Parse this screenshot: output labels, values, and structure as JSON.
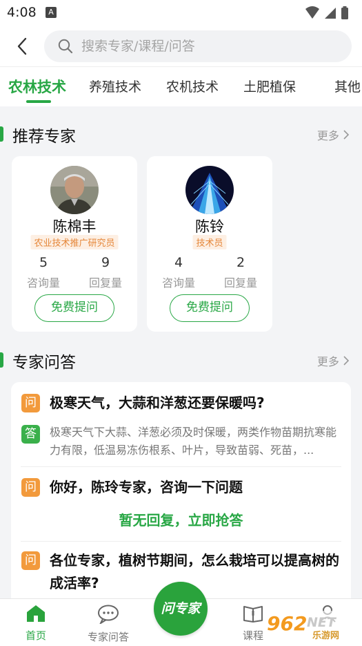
{
  "status_bar": {
    "time": "4:08",
    "notification_letter": "A"
  },
  "search": {
    "placeholder": "搜索专家/课程/问答"
  },
  "tabs": [
    "农林技术",
    "养殖技术",
    "农机技术",
    "土肥植保",
    "其他"
  ],
  "recommended": {
    "title": "推荐专家",
    "more": "更多",
    "experts": [
      {
        "name": "陈棉丰",
        "title": "农业技术推广研究员",
        "consult_count": "5",
        "consult_label": "咨询量",
        "reply_count": "9",
        "reply_label": "回复量",
        "button": "免费提问"
      },
      {
        "name": "陈铃",
        "title": "技术员",
        "consult_count": "4",
        "consult_label": "咨询量",
        "reply_count": "2",
        "reply_label": "回复量",
        "button": "免费提问"
      }
    ]
  },
  "qa": {
    "title": "专家问答",
    "more": "更多",
    "q_badge": "问",
    "a_badge": "答",
    "items": [
      {
        "question": "极寒天气，大蒜和洋葱还要保暖吗?",
        "answer": "极寒天气下大蒜、洋葱必须及时保暖，两类作物苗期抗寒能力有限，低温易冻伤根系、叶片，导致苗弱、死苗，..."
      },
      {
        "question": "你好，陈玲专家，咨询一下问题",
        "no_reply": "暂无回复，立即抢答"
      },
      {
        "question": "各位专家，植树节期间，怎么栽培可以提高树的成活率?"
      }
    ]
  },
  "bottom_nav": {
    "home": "首页",
    "expert_qa": "专家问答",
    "ask_expert": "问专家",
    "course": "课程"
  },
  "watermark": {
    "text": "962",
    "suffix": "NET",
    "sub": "乐游网"
  },
  "colors": {
    "accent": "#28a745",
    "orange": "#f29a3c",
    "tag_text": "#e5873a"
  }
}
